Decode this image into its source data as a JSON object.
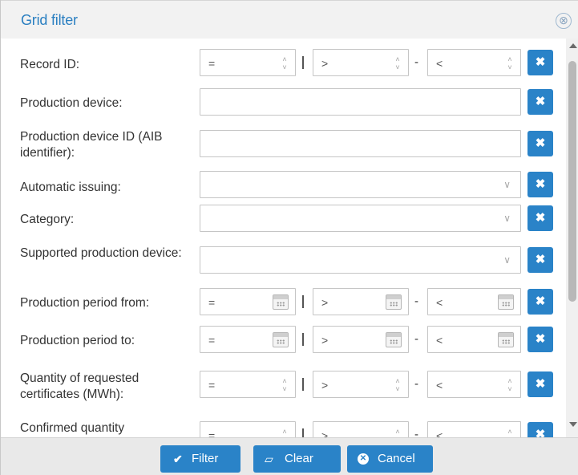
{
  "dialog": {
    "title": "Grid filter",
    "close_icon": "⊗"
  },
  "icons": {
    "clear": "✖",
    "spin_up": "˄",
    "spin_down": "˅",
    "chevron": "∨"
  },
  "rows": {
    "record_id": {
      "label": "Record ID:",
      "op1": "=",
      "op2": ">",
      "op3": "<",
      "sep1": "|",
      "sep2": "-"
    },
    "production_device": {
      "label": "Production device:"
    },
    "production_device_aib": {
      "label": "Production device ID (AIB identifier):"
    },
    "automatic_issuing": {
      "label": "Automatic issuing:"
    },
    "category": {
      "label": "Category:"
    },
    "supported_device": {
      "label": "Supported production device:"
    },
    "period_from": {
      "label": "Production period from:",
      "op1": "=",
      "op2": ">",
      "op3": "<",
      "sep1": "|",
      "sep2": "-"
    },
    "period_to": {
      "label": "Production period to:",
      "op1": "=",
      "op2": ">",
      "op3": "<",
      "sep1": "|",
      "sep2": "-"
    },
    "requested_qty": {
      "label": "Quantity of requested certificates (MWh):",
      "op1": "=",
      "op2": ">",
      "op3": "<",
      "sep1": "|",
      "sep2": "-"
    },
    "confirmed_qty": {
      "label": "Confirmed quantity",
      "op1": "=",
      "op2": ">",
      "op3": "<",
      "sep1": "|",
      "sep2": "-"
    }
  },
  "footer": {
    "filter_label": "Filter",
    "filter_icon": "✔",
    "clear_label": "Clear",
    "clear_icon": "▱",
    "cancel_label": "Cancel",
    "cancel_icon": "✕"
  },
  "colors": {
    "accent": "#2a83c8",
    "title": "#2a7fc1"
  }
}
